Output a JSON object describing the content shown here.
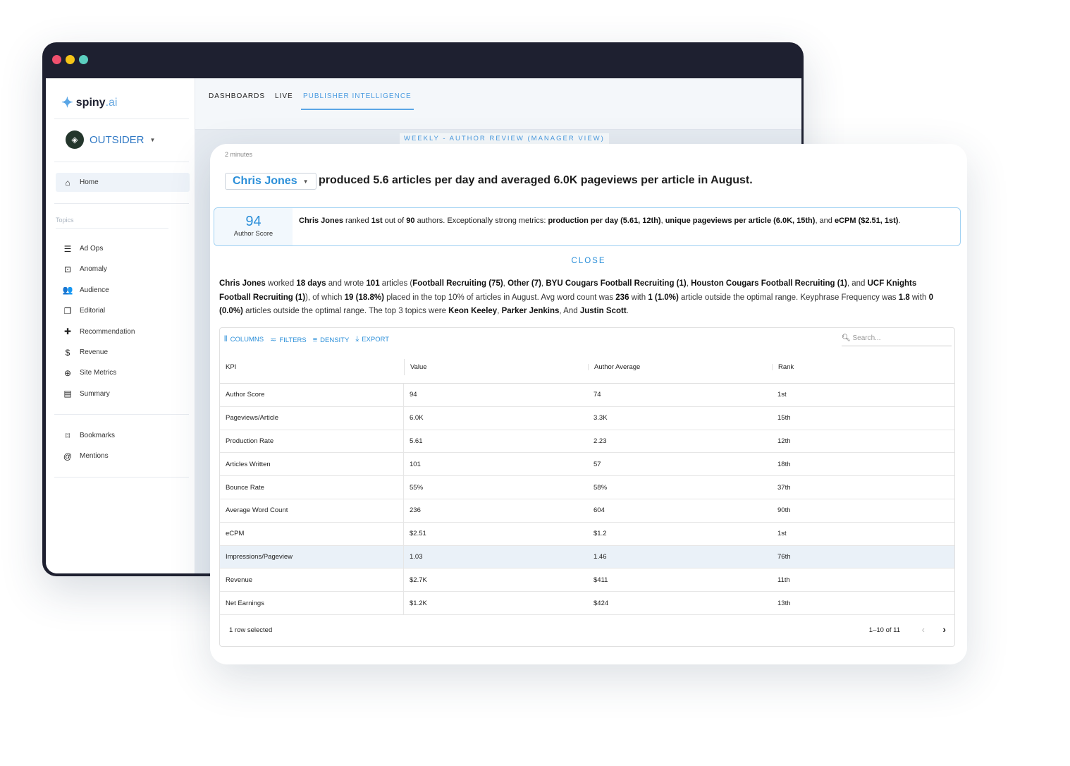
{
  "window": {
    "dot_colors": [
      "#f0506e",
      "#f5c518",
      "#5ccfc0"
    ]
  },
  "sidebar": {
    "logo_text": "spiny",
    "logo_suffix": ".ai",
    "org": "OUTSIDER",
    "home": {
      "label": "Home",
      "icon": "home-icon"
    },
    "topics_label": "Topics",
    "items": [
      {
        "label": "Ad Ops",
        "icon": "ad-ops-icon",
        "glyph": "☰"
      },
      {
        "label": "Anomaly",
        "icon": "anomaly-icon",
        "glyph": "⊡"
      },
      {
        "label": "Audience",
        "icon": "people-icon",
        "glyph": "👥"
      },
      {
        "label": "Editorial",
        "icon": "library-icon",
        "glyph": "❐"
      },
      {
        "label": "Recommendation",
        "icon": "recommendation-icon",
        "glyph": "✚"
      },
      {
        "label": "Revenue",
        "icon": "dollar-icon",
        "glyph": "$"
      },
      {
        "label": "Site Metrics",
        "icon": "globe-icon",
        "glyph": "⊕"
      },
      {
        "label": "Summary",
        "icon": "summary-icon",
        "glyph": "▤"
      }
    ],
    "bottom_items": [
      {
        "label": "Bookmarks",
        "icon": "bookmark-icon",
        "glyph": "⌑"
      },
      {
        "label": "Mentions",
        "icon": "at-icon",
        "glyph": "@"
      }
    ]
  },
  "tabs": [
    {
      "label": "DASHBOARDS"
    },
    {
      "label": "LIVE"
    },
    {
      "label": "PUBLISHER INTELLIGENCE",
      "active": true
    }
  ],
  "report_title": "WEEKLY - AUTHOR REVIEW (MANAGER VIEW)",
  "card": {
    "read_time": "2 minutes",
    "author": "Chris Jones",
    "headline": "produced 5.6 articles per day and averaged 6.0K pageviews per article in August.",
    "score": "94",
    "score_label": "Author Score",
    "score_text": [
      {
        "t": "Chris Jones",
        "b": true
      },
      {
        "t": " ranked "
      },
      {
        "t": "1st",
        "b": true
      },
      {
        "t": " out of "
      },
      {
        "t": "90",
        "b": true
      },
      {
        "t": " authors. Exceptionally strong metrics: "
      },
      {
        "t": "production per day (5.61, 12th)",
        "b": true
      },
      {
        "t": ", "
      },
      {
        "t": "unique pageviews per article (6.0K, 15th)",
        "b": true
      },
      {
        "t": ", and "
      },
      {
        "t": "eCPM ($2.51, 1st)",
        "b": true
      },
      {
        "t": "."
      }
    ],
    "close_label": "CLOSE",
    "summary": [
      {
        "t": "Chris Jones",
        "b": true
      },
      {
        "t": " worked "
      },
      {
        "t": "18 days",
        "b": true
      },
      {
        "t": " and wrote "
      },
      {
        "t": "101",
        "b": true
      },
      {
        "t": " articles ("
      },
      {
        "t": "Football Recruiting (75)",
        "b": true
      },
      {
        "t": ", "
      },
      {
        "t": "Other (7)",
        "b": true
      },
      {
        "t": ", "
      },
      {
        "t": "BYU Cougars Football Recruiting (1)",
        "b": true
      },
      {
        "t": ", "
      },
      {
        "t": "Houston Cougars Football Recruiting (1)",
        "b": true
      },
      {
        "t": ", and "
      },
      {
        "t": "UCF Knights Football Recruiting (1)",
        "b": true
      },
      {
        "t": "), of which "
      },
      {
        "t": "19 (18.8%)",
        "b": true
      },
      {
        "t": " placed in the top 10% of articles in August. Avg word count was "
      },
      {
        "t": "236",
        "b": true
      },
      {
        "t": " with "
      },
      {
        "t": "1 (1.0%)",
        "b": true
      },
      {
        "t": " article outside the optimal range. Keyphrase Frequency was "
      },
      {
        "t": "1.8",
        "b": true
      },
      {
        "t": " with "
      },
      {
        "t": "0 (0.0%)",
        "b": true
      },
      {
        "t": " articles outside the optimal range. The top 3 topics were "
      },
      {
        "t": "Keon Keeley",
        "b": true
      },
      {
        "t": ", "
      },
      {
        "t": "Parker Jenkins",
        "b": true
      },
      {
        "t": ", And "
      },
      {
        "t": "Justin Scott",
        "b": true
      },
      {
        "t": "."
      }
    ]
  },
  "grid": {
    "toolbar": {
      "columns": "COLUMNS",
      "filters": "FILTERS",
      "density": "DENSITY",
      "export": "EXPORT"
    },
    "search_placeholder": "Search...",
    "columns": [
      "KPI",
      "Value",
      "Author Average",
      "Rank"
    ],
    "rows": [
      [
        "Author Score",
        "94",
        "74",
        "1st"
      ],
      [
        "Pageviews/Article",
        "6.0K",
        "3.3K",
        "15th"
      ],
      [
        "Production Rate",
        "5.61",
        "2.23",
        "12th"
      ],
      [
        "Articles Written",
        "101",
        "57",
        "18th"
      ],
      [
        "Bounce Rate",
        "55%",
        "58%",
        "37th"
      ],
      [
        "Average Word Count",
        "236",
        "604",
        "90th"
      ],
      [
        "eCPM",
        "$2.51",
        "$1.2",
        "1st"
      ],
      [
        "Impressions/Pageview",
        "1.03",
        "1.46",
        "76th"
      ],
      [
        "Revenue",
        "$2.7K",
        "$411",
        "11th"
      ],
      [
        "Net Earnings",
        "$1.2K",
        "$424",
        "13th"
      ]
    ],
    "selected_row": 7,
    "selection_text": "1 row selected",
    "pagination": "1–10 of 11"
  }
}
